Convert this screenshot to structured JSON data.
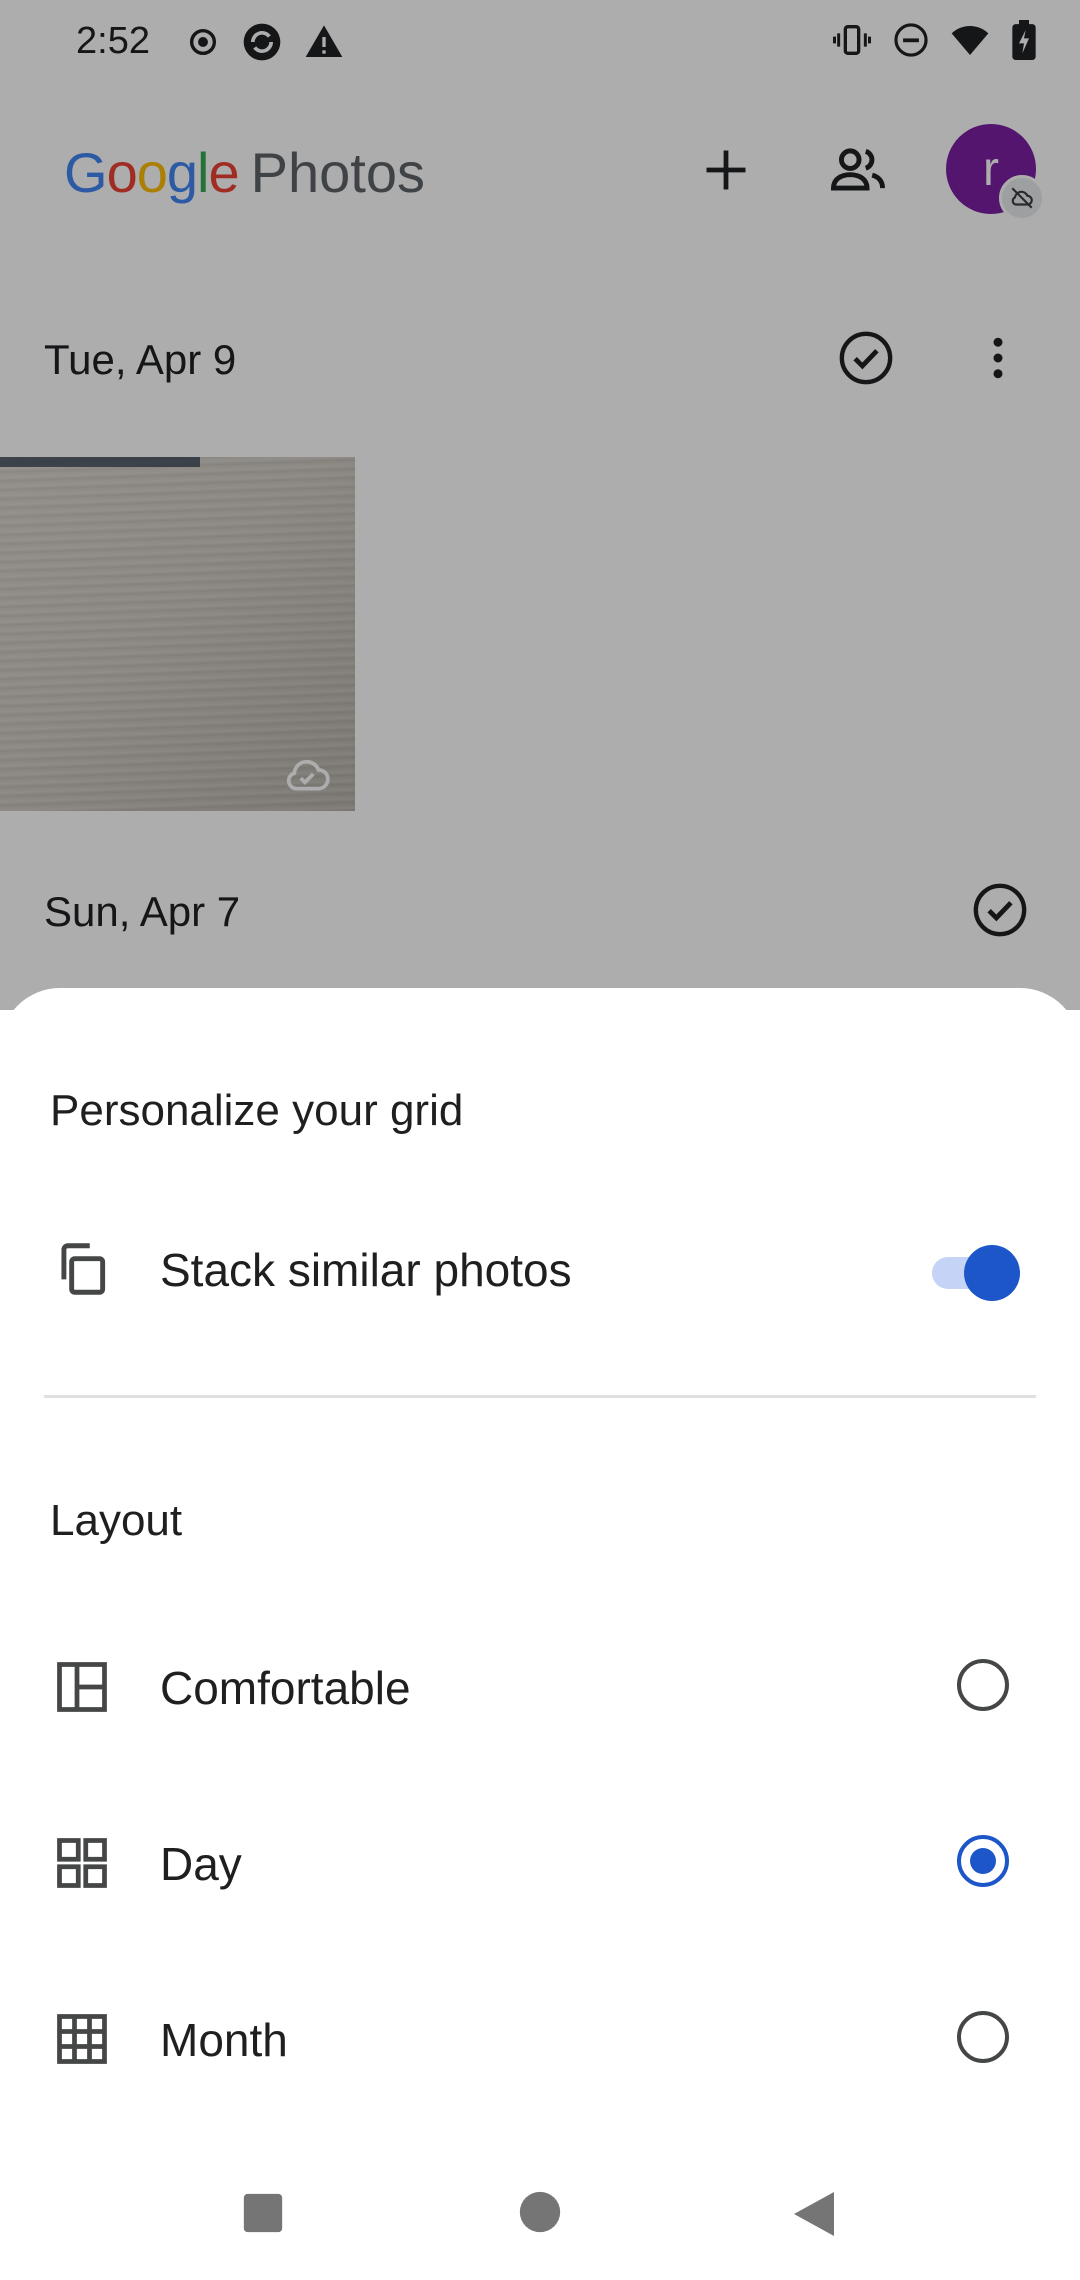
{
  "status_bar": {
    "time": "2:52"
  },
  "app": {
    "logo": {
      "g1": "G",
      "g2": "o",
      "g3": "o",
      "g4": "g",
      "g5": "l",
      "g6": "e",
      "word": "Photos"
    },
    "avatar_letter": "r",
    "dates": [
      {
        "label": "Tue, Apr 9"
      },
      {
        "label": "Sun, Apr 7"
      }
    ]
  },
  "sheet": {
    "title": "Personalize your grid",
    "stack": {
      "label": "Stack similar photos",
      "enabled": true
    },
    "layout_heading": "Layout",
    "layout_options": [
      {
        "label": "Comfortable",
        "selected": false,
        "icon": "comfortable-layout-icon"
      },
      {
        "label": "Day",
        "selected": true,
        "icon": "day-layout-icon"
      },
      {
        "label": "Month",
        "selected": false,
        "icon": "month-layout-icon"
      }
    ]
  },
  "colors": {
    "accent": "#1d56c9",
    "avatar": "#7b1fa2",
    "g_blue": "#4285f4",
    "g_red": "#ea4335",
    "g_yellow": "#fbbc05",
    "g_green": "#34a853"
  }
}
